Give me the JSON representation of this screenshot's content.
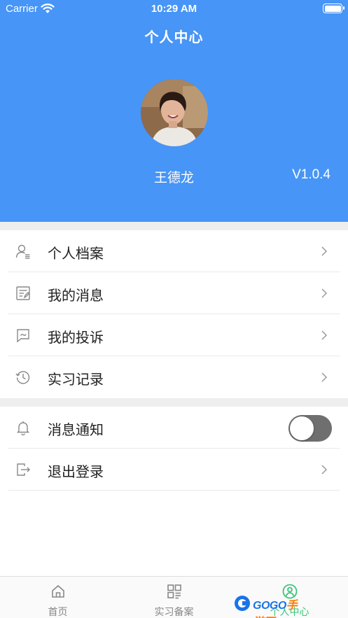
{
  "status_bar": {
    "carrier": "Carrier",
    "time": "10:29 AM"
  },
  "header": {
    "title": "个人中心",
    "user_name": "王德龙",
    "version": "V1.0.4",
    "background": "#4795f6"
  },
  "menu_group_1": [
    {
      "label": "个人档案",
      "icon": "user-profile-icon"
    },
    {
      "label": "我的消息",
      "icon": "message-doc-icon"
    },
    {
      "label": "我的投诉",
      "icon": "complaint-chat-icon"
    },
    {
      "label": "实习记录",
      "icon": "history-clock-icon"
    }
  ],
  "menu_group_2": [
    {
      "label": "消息通知",
      "icon": "bell-icon",
      "toggle": false
    },
    {
      "label": "退出登录",
      "icon": "logout-icon"
    }
  ],
  "tabbar": {
    "tabs": [
      {
        "label": "首页",
        "icon": "home-icon",
        "active": false
      },
      {
        "label": "实习备案",
        "icon": "qr-grid-icon",
        "active": false
      },
      {
        "label": "个人中心",
        "icon": "person-circle-icon",
        "active": true
      }
    ],
    "active_color": "#3cc47c"
  },
  "watermark": {
    "prefix": "GOGO",
    "suffix": "手游网"
  }
}
